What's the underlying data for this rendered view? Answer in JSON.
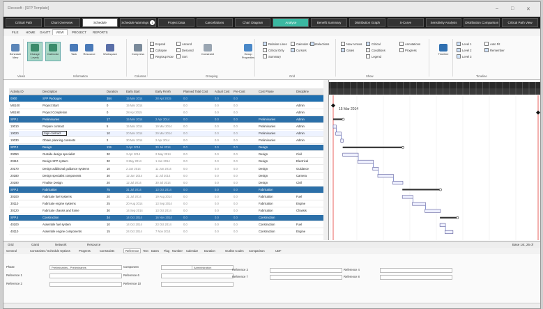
{
  "window": {
    "title": "Elecosoft - [SFP Template]",
    "controls": [
      "–",
      "□",
      "✕"
    ]
  },
  "nav_buttons": [
    {
      "label": "Critical Path",
      "state": "normal"
    },
    {
      "label": "Chart Overview",
      "state": "normal"
    },
    {
      "label": "Schedule",
      "state": "active"
    },
    {
      "label": "Schedule Warnings",
      "state": "normal",
      "badge": "1"
    },
    {
      "label": "Project Data",
      "state": "normal"
    },
    {
      "label": "Cancellations",
      "state": "normal"
    },
    {
      "label": "Chart Diagram",
      "state": "normal"
    },
    {
      "label": "Analyse",
      "state": "teal"
    },
    {
      "label": "Benefit Summary",
      "state": "normal"
    },
    {
      "label": "Distribution Graph",
      "state": "normal"
    },
    {
      "label": "S-Curve",
      "state": "normal"
    },
    {
      "label": "Sensitivity Analysis",
      "state": "normal"
    },
    {
      "label": "Distribution Comparison",
      "state": "normal"
    },
    {
      "label": "Critical Path View",
      "state": "normal"
    }
  ],
  "ribbon_tabs": [
    "FILE",
    "HOME",
    "GANTT",
    "VIEW",
    "PROJECT",
    "REPORTS"
  ],
  "ribbon_selected": "VIEW",
  "ribbon": {
    "big_buttons": [
      {
        "label": "Schedule View",
        "on": false
      },
      {
        "label": "Change Levels",
        "on": true
      },
      {
        "label": "Calendar",
        "on": true
      },
      {
        "label": "Task",
        "on": false
      },
      {
        "label": "Resource",
        "on": false
      },
      {
        "label": "Workspace",
        "on": false
      },
      {
        "label": "Compress",
        "on": false
      },
      {
        "label": "Constraint",
        "on": false
      },
      {
        "label": "Group Properties",
        "on": false
      },
      {
        "label": "Timeline",
        "on": false
      }
    ],
    "checks": [
      {
        "label": "Expand",
        "on": false
      },
      {
        "label": "Collapse",
        "on": false
      },
      {
        "label": "Regroup Now",
        "on": false
      },
      {
        "label": "Ascend",
        "on": false
      },
      {
        "label": "Descend",
        "on": false
      },
      {
        "label": "Sort",
        "on": false
      },
      {
        "label": "Relation Lines",
        "on": true
      },
      {
        "label": "Critical Only",
        "on": false
      },
      {
        "label": "Summary",
        "on": false
      },
      {
        "label": "Calendar Lines",
        "on": false
      },
      {
        "label": "Cursors",
        "on": true
      },
      {
        "label": "Selections",
        "on": true
      },
      {
        "label": "Now Arrows",
        "on": false
      },
      {
        "label": "Gates",
        "on": true
      },
      {
        "label": "Critical",
        "on": true
      },
      {
        "label": "Conditions",
        "on": false
      },
      {
        "label": "Legend",
        "on": false
      },
      {
        "label": "Annotations",
        "on": false
      },
      {
        "label": "Progress",
        "on": false
      },
      {
        "label": "Level 1",
        "on": true
      },
      {
        "label": "Level 2",
        "on": true
      },
      {
        "label": "Level 3",
        "on": true
      },
      {
        "label": "Auto Fit",
        "on": false
      },
      {
        "label": "Remember",
        "on": true
      }
    ],
    "groups": [
      "Views",
      "Information",
      "Columns",
      "Grouping",
      "Grid",
      "Show",
      "Timeline"
    ]
  },
  "grid": {
    "columns": [
      "Activity ID",
      "Description",
      "Duration",
      "Early Start",
      "Early Finish",
      "Planned Total Cost",
      "Actual Cost",
      "Pre-Cost",
      "Cost Phase",
      "Discipline"
    ],
    "rows": [
      {
        "type": "sum",
        "id": "0000",
        "desc": "SFP Packages",
        "dur": "384",
        "start": "15 Mar 2014",
        "finish": "28 Apr 2015",
        "pc": "0.0",
        "ac": "0.0",
        "pre": "0.0",
        "phase": "",
        "disc": ""
      },
      {
        "type": "task",
        "id": "MS100",
        "desc": "Project Start",
        "dur": "0",
        "start": "15 Mar 2014",
        "finish": "",
        "pc": "0.0",
        "ac": "0.0",
        "pre": "0.0",
        "phase": "",
        "disc": "Admin"
      },
      {
        "type": "task",
        "id": "MS190",
        "desc": "Project Completion",
        "dur": "0",
        "start": "28 Apr 2015",
        "finish": "",
        "pc": "0.0",
        "ac": "0.0",
        "pre": "0.0",
        "phase": "",
        "disc": "Admin"
      },
      {
        "type": "hdr",
        "id": "SFP.1",
        "desc": "Preliminaries",
        "dur": "17",
        "start": "15 Mar 2014",
        "finish": "2 Apr 2014",
        "pc": "0.0",
        "ac": "0.0",
        "pre": "0.0",
        "phase": "Preliminaries",
        "disc": "Admin"
      },
      {
        "type": "task",
        "id": "10010",
        "desc": "Prepare contract",
        "dur": "5",
        "start": "15 Mar 2014",
        "finish": "19 Mar 2014",
        "pc": "0.0",
        "ac": "0.0",
        "pre": "0.0",
        "phase": "Preliminaries",
        "disc": "Admin"
      },
      {
        "type": "sel",
        "id": "10020",
        "desc": "Sign contract",
        "dur": "10",
        "start": "20 Mar 2014",
        "finish": "29 Mar 2014",
        "pc": "0.0",
        "ac": "0.0",
        "pre": "0.0",
        "phase": "Preliminaries",
        "disc": "Admin"
      },
      {
        "type": "task",
        "id": "10030",
        "desc": "Obtain planning consents",
        "dur": "2",
        "start": "30 Mar 2014",
        "finish": "2 Apr 2014",
        "pc": "0.0",
        "ac": "0.0",
        "pre": "0.0",
        "phase": "Preliminaries",
        "disc": "Admin"
      },
      {
        "type": "hdr",
        "id": "SFP.2",
        "desc": "Design",
        "dur": "119",
        "start": "3 Apr 2014",
        "finish": "30 Jul 2014",
        "pc": "0.0",
        "ac": "0.0",
        "pre": "0.0",
        "phase": "Design",
        "disc": ""
      },
      {
        "type": "task",
        "id": "20050",
        "desc": "Outside design specialist",
        "dur": "30",
        "start": "3 Apr 2014",
        "finish": "2 May 2014",
        "pc": "0.0",
        "ac": "0.0",
        "pre": "0.0",
        "phase": "Design",
        "disc": "Civil"
      },
      {
        "type": "task",
        "id": "20110",
        "desc": "Design SFP system",
        "dur": "30",
        "start": "3 May 2014",
        "finish": "1 Jun 2014",
        "pc": "0.0",
        "ac": "0.0",
        "pre": "0.0",
        "phase": "Design",
        "disc": "Electrical"
      },
      {
        "type": "task",
        "id": "20170",
        "desc": "Design additional guidance systems",
        "dur": "10",
        "start": "2 Jun 2014",
        "finish": "11 Jun 2014",
        "pc": "0.0",
        "ac": "0.0",
        "pre": "0.0",
        "phase": "Design",
        "disc": "Guidance"
      },
      {
        "type": "task",
        "id": "20180",
        "desc": "Design specialist components",
        "dur": "30",
        "start": "12 Jun 2014",
        "finish": "11 Jul 2014",
        "pc": "0.0",
        "ac": "0.0",
        "pre": "0.0",
        "phase": "Design",
        "disc": "Camera"
      },
      {
        "type": "task",
        "id": "20190",
        "desc": "Finalise Design",
        "dur": "20",
        "start": "12 Jul 2014",
        "finish": "30 Jul 2014",
        "pc": "0.0",
        "ac": "0.0",
        "pre": "0.0",
        "phase": "Design",
        "disc": "Civil"
      },
      {
        "type": "hdr",
        "id": "SFP.3",
        "desc": "Fabrication",
        "dur": "75",
        "start": "31 Jul 2014",
        "finish": "13 Oct 2014",
        "pc": "0.0",
        "ac": "0.0",
        "pre": "0.0",
        "phase": "Fabrication",
        "disc": ""
      },
      {
        "type": "task",
        "id": "30100",
        "desc": "Fabricate fuel systems",
        "dur": "20",
        "start": "31 Jul 2014",
        "finish": "19 Aug 2014",
        "pc": "0.0",
        "ac": "0.0",
        "pre": "0.0",
        "phase": "Fabrication",
        "disc": "Fuel"
      },
      {
        "type": "task",
        "id": "30110",
        "desc": "Fabricate engine systems",
        "dur": "25",
        "start": "20 Aug 2014",
        "finish": "13 Sep 2014",
        "pc": "0.0",
        "ac": "0.0",
        "pre": "0.0",
        "phase": "Fabrication",
        "disc": "Engine"
      },
      {
        "type": "task",
        "id": "30120",
        "desc": "Fabricate chassis and frame",
        "dur": "30",
        "start": "14 Sep 2014",
        "finish": "13 Oct 2014",
        "pc": "0.0",
        "ac": "0.0",
        "pre": "0.0",
        "phase": "Fabrication",
        "disc": "Chassis"
      },
      {
        "type": "hdr",
        "id": "SFP.4",
        "desc": "Construction",
        "dur": "34",
        "start": "14 Oct 2014",
        "finish": "16 Nov 2014",
        "pc": "0.0",
        "ac": "0.0",
        "pre": "0.0",
        "phase": "Construction",
        "disc": ""
      },
      {
        "type": "task",
        "id": "40100",
        "desc": "Assemble fuel system",
        "dur": "10",
        "start": "14 Oct 2014",
        "finish": "23 Oct 2014",
        "pc": "0.0",
        "ac": "0.0",
        "pre": "0.0",
        "phase": "Construction",
        "disc": "Fuel"
      },
      {
        "type": "task",
        "id": "40110",
        "desc": "Assemble engine components",
        "dur": "15",
        "start": "24 Oct 2014",
        "finish": "7 Nov 2014",
        "pc": "0.0",
        "ac": "0.0",
        "pre": "0.0",
        "phase": "Construction",
        "disc": "Engine"
      }
    ]
  },
  "gantt": {
    "label": "15 Mar 2014"
  },
  "bottom_bar": {
    "items": [
      "Grid",
      "Gantt",
      "Network",
      "Resource"
    ],
    "right": "Base 1st, 26 of"
  },
  "detail_tabs": [
    "General",
    "Constraints / Schedule Options",
    "Progress",
    "Constraints",
    "Reference",
    "Text",
    "Dates",
    "Flag",
    "Number",
    "Calendar",
    "Duration",
    "Outline Codes",
    "Comparison",
    "UDF"
  ],
  "detail_fields": [
    {
      "label": "Phase",
      "value": "Preliminaries - Preliminaries"
    },
    {
      "label": "Reference 1",
      "value": ""
    },
    {
      "label": "Reference 2",
      "value": ""
    },
    {
      "label": "Component",
      "value": ""
    },
    {
      "label": "Reference 6",
      "value": ""
    },
    {
      "label": "Reference 10",
      "value": ""
    },
    {
      "label": "Admin",
      "value": "Administration"
    },
    {
      "label": "Reference 3",
      "value": ""
    },
    {
      "label": "Reference 7",
      "value": ""
    },
    {
      "label": "Reference 4",
      "value": ""
    },
    {
      "label": "Reference 8",
      "value": ""
    }
  ]
}
